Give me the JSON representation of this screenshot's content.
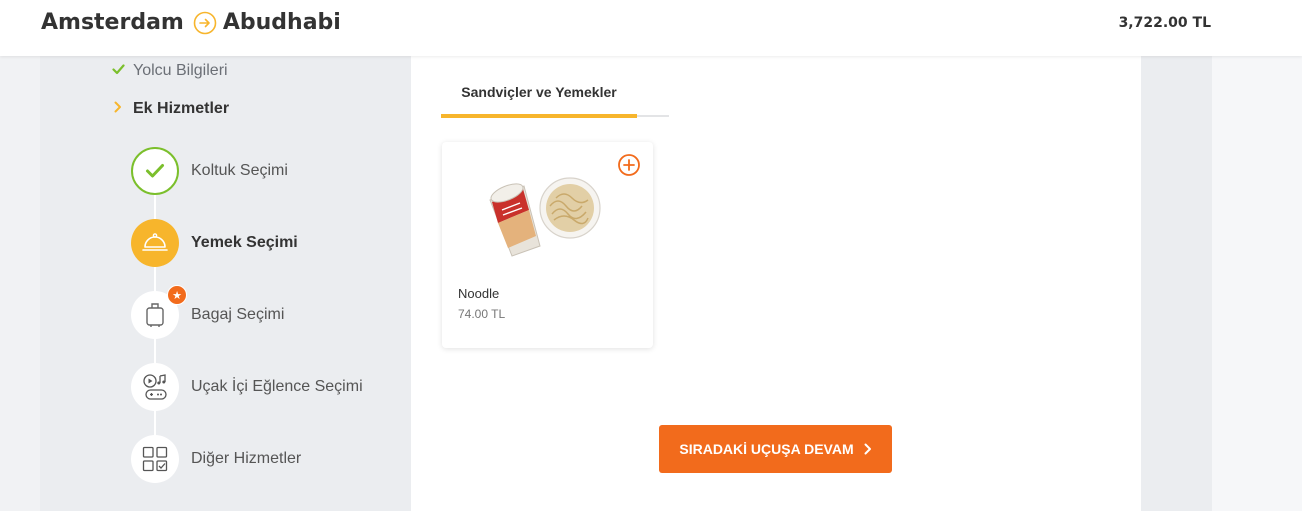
{
  "header": {
    "origin": "Amsterdam",
    "destination": "Abudhabi",
    "arrow_icon": "arrow-right-circle-icon",
    "total_price": "3,722.00 TL"
  },
  "sidebar": {
    "completed_step": "Yolcu Bilgileri",
    "current_step": "Ek Hizmetler",
    "sub_steps": [
      {
        "label": "Koltuk Seçimi",
        "icon": "check-icon",
        "state": "done"
      },
      {
        "label": "Yemek Seçimi",
        "icon": "cloche-icon",
        "state": "active"
      },
      {
        "label": "Bagaj Seçimi",
        "icon": "luggage-icon",
        "state": "pending"
      },
      {
        "label": "Uçak İçi Eğlence Seçimi",
        "icon": "entertainment-icon",
        "state": "pending"
      },
      {
        "label": "Diğer Hizmetler",
        "icon": "grid-icon",
        "state": "pending"
      }
    ]
  },
  "main": {
    "tab_label": "Sandviçler ve Yemekler",
    "product": {
      "name": "Noodle",
      "price": "74.00 TL"
    },
    "continue_label": "SIRADAKİ UÇUŞA DEVAM"
  },
  "colors": {
    "accent": "#f7b52c",
    "cta": "#f26b1c",
    "success": "#7bbf2c"
  }
}
